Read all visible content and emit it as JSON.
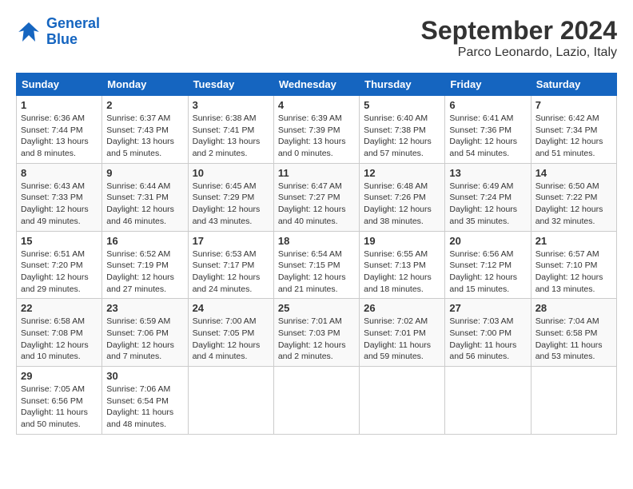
{
  "logo": {
    "line1": "General",
    "line2": "Blue"
  },
  "title": "September 2024",
  "subtitle": "Parco Leonardo, Lazio, Italy",
  "days_of_week": [
    "Sunday",
    "Monday",
    "Tuesday",
    "Wednesday",
    "Thursday",
    "Friday",
    "Saturday"
  ],
  "weeks": [
    [
      {
        "day": 1,
        "info": "Sunrise: 6:36 AM\nSunset: 7:44 PM\nDaylight: 13 hours\nand 8 minutes."
      },
      {
        "day": 2,
        "info": "Sunrise: 6:37 AM\nSunset: 7:43 PM\nDaylight: 13 hours\nand 5 minutes."
      },
      {
        "day": 3,
        "info": "Sunrise: 6:38 AM\nSunset: 7:41 PM\nDaylight: 13 hours\nand 2 minutes."
      },
      {
        "day": 4,
        "info": "Sunrise: 6:39 AM\nSunset: 7:39 PM\nDaylight: 13 hours\nand 0 minutes."
      },
      {
        "day": 5,
        "info": "Sunrise: 6:40 AM\nSunset: 7:38 PM\nDaylight: 12 hours\nand 57 minutes."
      },
      {
        "day": 6,
        "info": "Sunrise: 6:41 AM\nSunset: 7:36 PM\nDaylight: 12 hours\nand 54 minutes."
      },
      {
        "day": 7,
        "info": "Sunrise: 6:42 AM\nSunset: 7:34 PM\nDaylight: 12 hours\nand 51 minutes."
      }
    ],
    [
      {
        "day": 8,
        "info": "Sunrise: 6:43 AM\nSunset: 7:33 PM\nDaylight: 12 hours\nand 49 minutes."
      },
      {
        "day": 9,
        "info": "Sunrise: 6:44 AM\nSunset: 7:31 PM\nDaylight: 12 hours\nand 46 minutes."
      },
      {
        "day": 10,
        "info": "Sunrise: 6:45 AM\nSunset: 7:29 PM\nDaylight: 12 hours\nand 43 minutes."
      },
      {
        "day": 11,
        "info": "Sunrise: 6:47 AM\nSunset: 7:27 PM\nDaylight: 12 hours\nand 40 minutes."
      },
      {
        "day": 12,
        "info": "Sunrise: 6:48 AM\nSunset: 7:26 PM\nDaylight: 12 hours\nand 38 minutes."
      },
      {
        "day": 13,
        "info": "Sunrise: 6:49 AM\nSunset: 7:24 PM\nDaylight: 12 hours\nand 35 minutes."
      },
      {
        "day": 14,
        "info": "Sunrise: 6:50 AM\nSunset: 7:22 PM\nDaylight: 12 hours\nand 32 minutes."
      }
    ],
    [
      {
        "day": 15,
        "info": "Sunrise: 6:51 AM\nSunset: 7:20 PM\nDaylight: 12 hours\nand 29 minutes."
      },
      {
        "day": 16,
        "info": "Sunrise: 6:52 AM\nSunset: 7:19 PM\nDaylight: 12 hours\nand 27 minutes."
      },
      {
        "day": 17,
        "info": "Sunrise: 6:53 AM\nSunset: 7:17 PM\nDaylight: 12 hours\nand 24 minutes."
      },
      {
        "day": 18,
        "info": "Sunrise: 6:54 AM\nSunset: 7:15 PM\nDaylight: 12 hours\nand 21 minutes."
      },
      {
        "day": 19,
        "info": "Sunrise: 6:55 AM\nSunset: 7:13 PM\nDaylight: 12 hours\nand 18 minutes."
      },
      {
        "day": 20,
        "info": "Sunrise: 6:56 AM\nSunset: 7:12 PM\nDaylight: 12 hours\nand 15 minutes."
      },
      {
        "day": 21,
        "info": "Sunrise: 6:57 AM\nSunset: 7:10 PM\nDaylight: 12 hours\nand 13 minutes."
      }
    ],
    [
      {
        "day": 22,
        "info": "Sunrise: 6:58 AM\nSunset: 7:08 PM\nDaylight: 12 hours\nand 10 minutes."
      },
      {
        "day": 23,
        "info": "Sunrise: 6:59 AM\nSunset: 7:06 PM\nDaylight: 12 hours\nand 7 minutes."
      },
      {
        "day": 24,
        "info": "Sunrise: 7:00 AM\nSunset: 7:05 PM\nDaylight: 12 hours\nand 4 minutes."
      },
      {
        "day": 25,
        "info": "Sunrise: 7:01 AM\nSunset: 7:03 PM\nDaylight: 12 hours\nand 2 minutes."
      },
      {
        "day": 26,
        "info": "Sunrise: 7:02 AM\nSunset: 7:01 PM\nDaylight: 11 hours\nand 59 minutes."
      },
      {
        "day": 27,
        "info": "Sunrise: 7:03 AM\nSunset: 7:00 PM\nDaylight: 11 hours\nand 56 minutes."
      },
      {
        "day": 28,
        "info": "Sunrise: 7:04 AM\nSunset: 6:58 PM\nDaylight: 11 hours\nand 53 minutes."
      }
    ],
    [
      {
        "day": 29,
        "info": "Sunrise: 7:05 AM\nSunset: 6:56 PM\nDaylight: 11 hours\nand 50 minutes."
      },
      {
        "day": 30,
        "info": "Sunrise: 7:06 AM\nSunset: 6:54 PM\nDaylight: 11 hours\nand 48 minutes."
      },
      null,
      null,
      null,
      null,
      null
    ]
  ]
}
